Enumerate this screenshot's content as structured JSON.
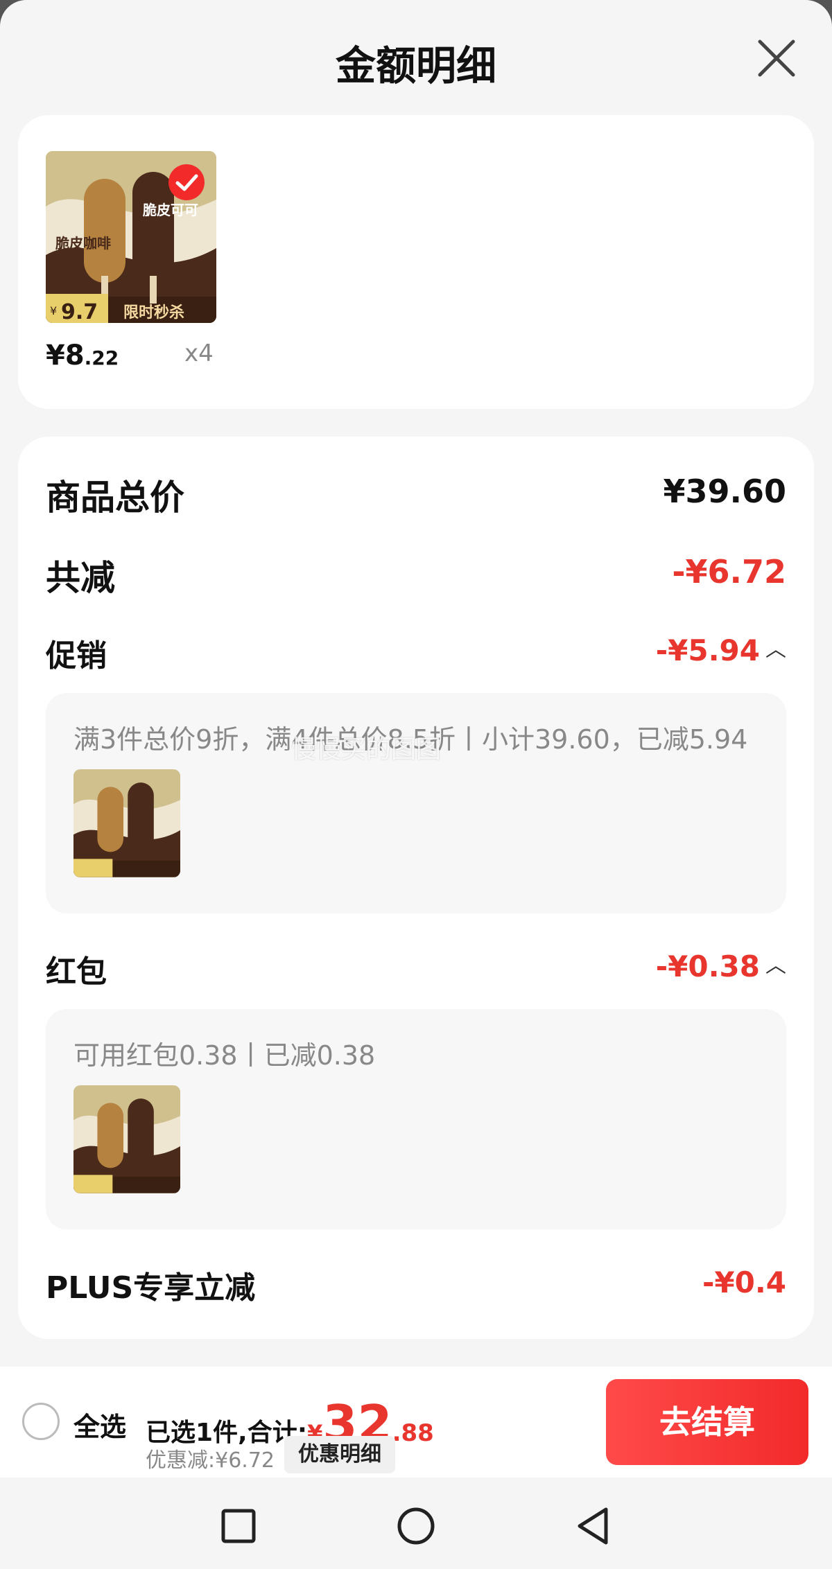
{
  "header": {
    "title": "金额明细",
    "close_icon": "close-icon"
  },
  "product": {
    "price_int": "¥8",
    "price_dec": ".22",
    "qty": "x4",
    "thumb_labels": {
      "left": "脆皮咖啡",
      "right": "脆皮可可",
      "banner": "限时秒杀",
      "price": "9.7",
      "currency": "¥"
    },
    "checked": true
  },
  "summary": {
    "goods_total_label": "商品总价",
    "goods_total_value": "¥39.60",
    "total_discount_label": "共减",
    "total_discount_value": "-¥6.72"
  },
  "promotion": {
    "label": "促销",
    "value": "-¥5.94",
    "detail": "满3件总价9折，满4件总价8.5折丨小计39.60，已减5.94"
  },
  "redpacket": {
    "label": "红包",
    "value": "-¥0.38",
    "detail": "可用红包0.38丨已减0.38"
  },
  "plus": {
    "label": "PLUS专享立减",
    "value": "-¥0.4"
  },
  "watermark": "慢慢买的图图",
  "bottom": {
    "select_all": "全选",
    "selected_text": "已选1件,合计:",
    "total_currency": "¥",
    "total_int": "32",
    "total_dec": ".88",
    "discount_text": "优惠减:¥6.72",
    "detail_button": "优惠明细",
    "checkout_button": "去结算"
  },
  "colors": {
    "accent_red": "#e8362f",
    "checkout_red": "#f22a2a",
    "background": "#f5f5f5"
  }
}
